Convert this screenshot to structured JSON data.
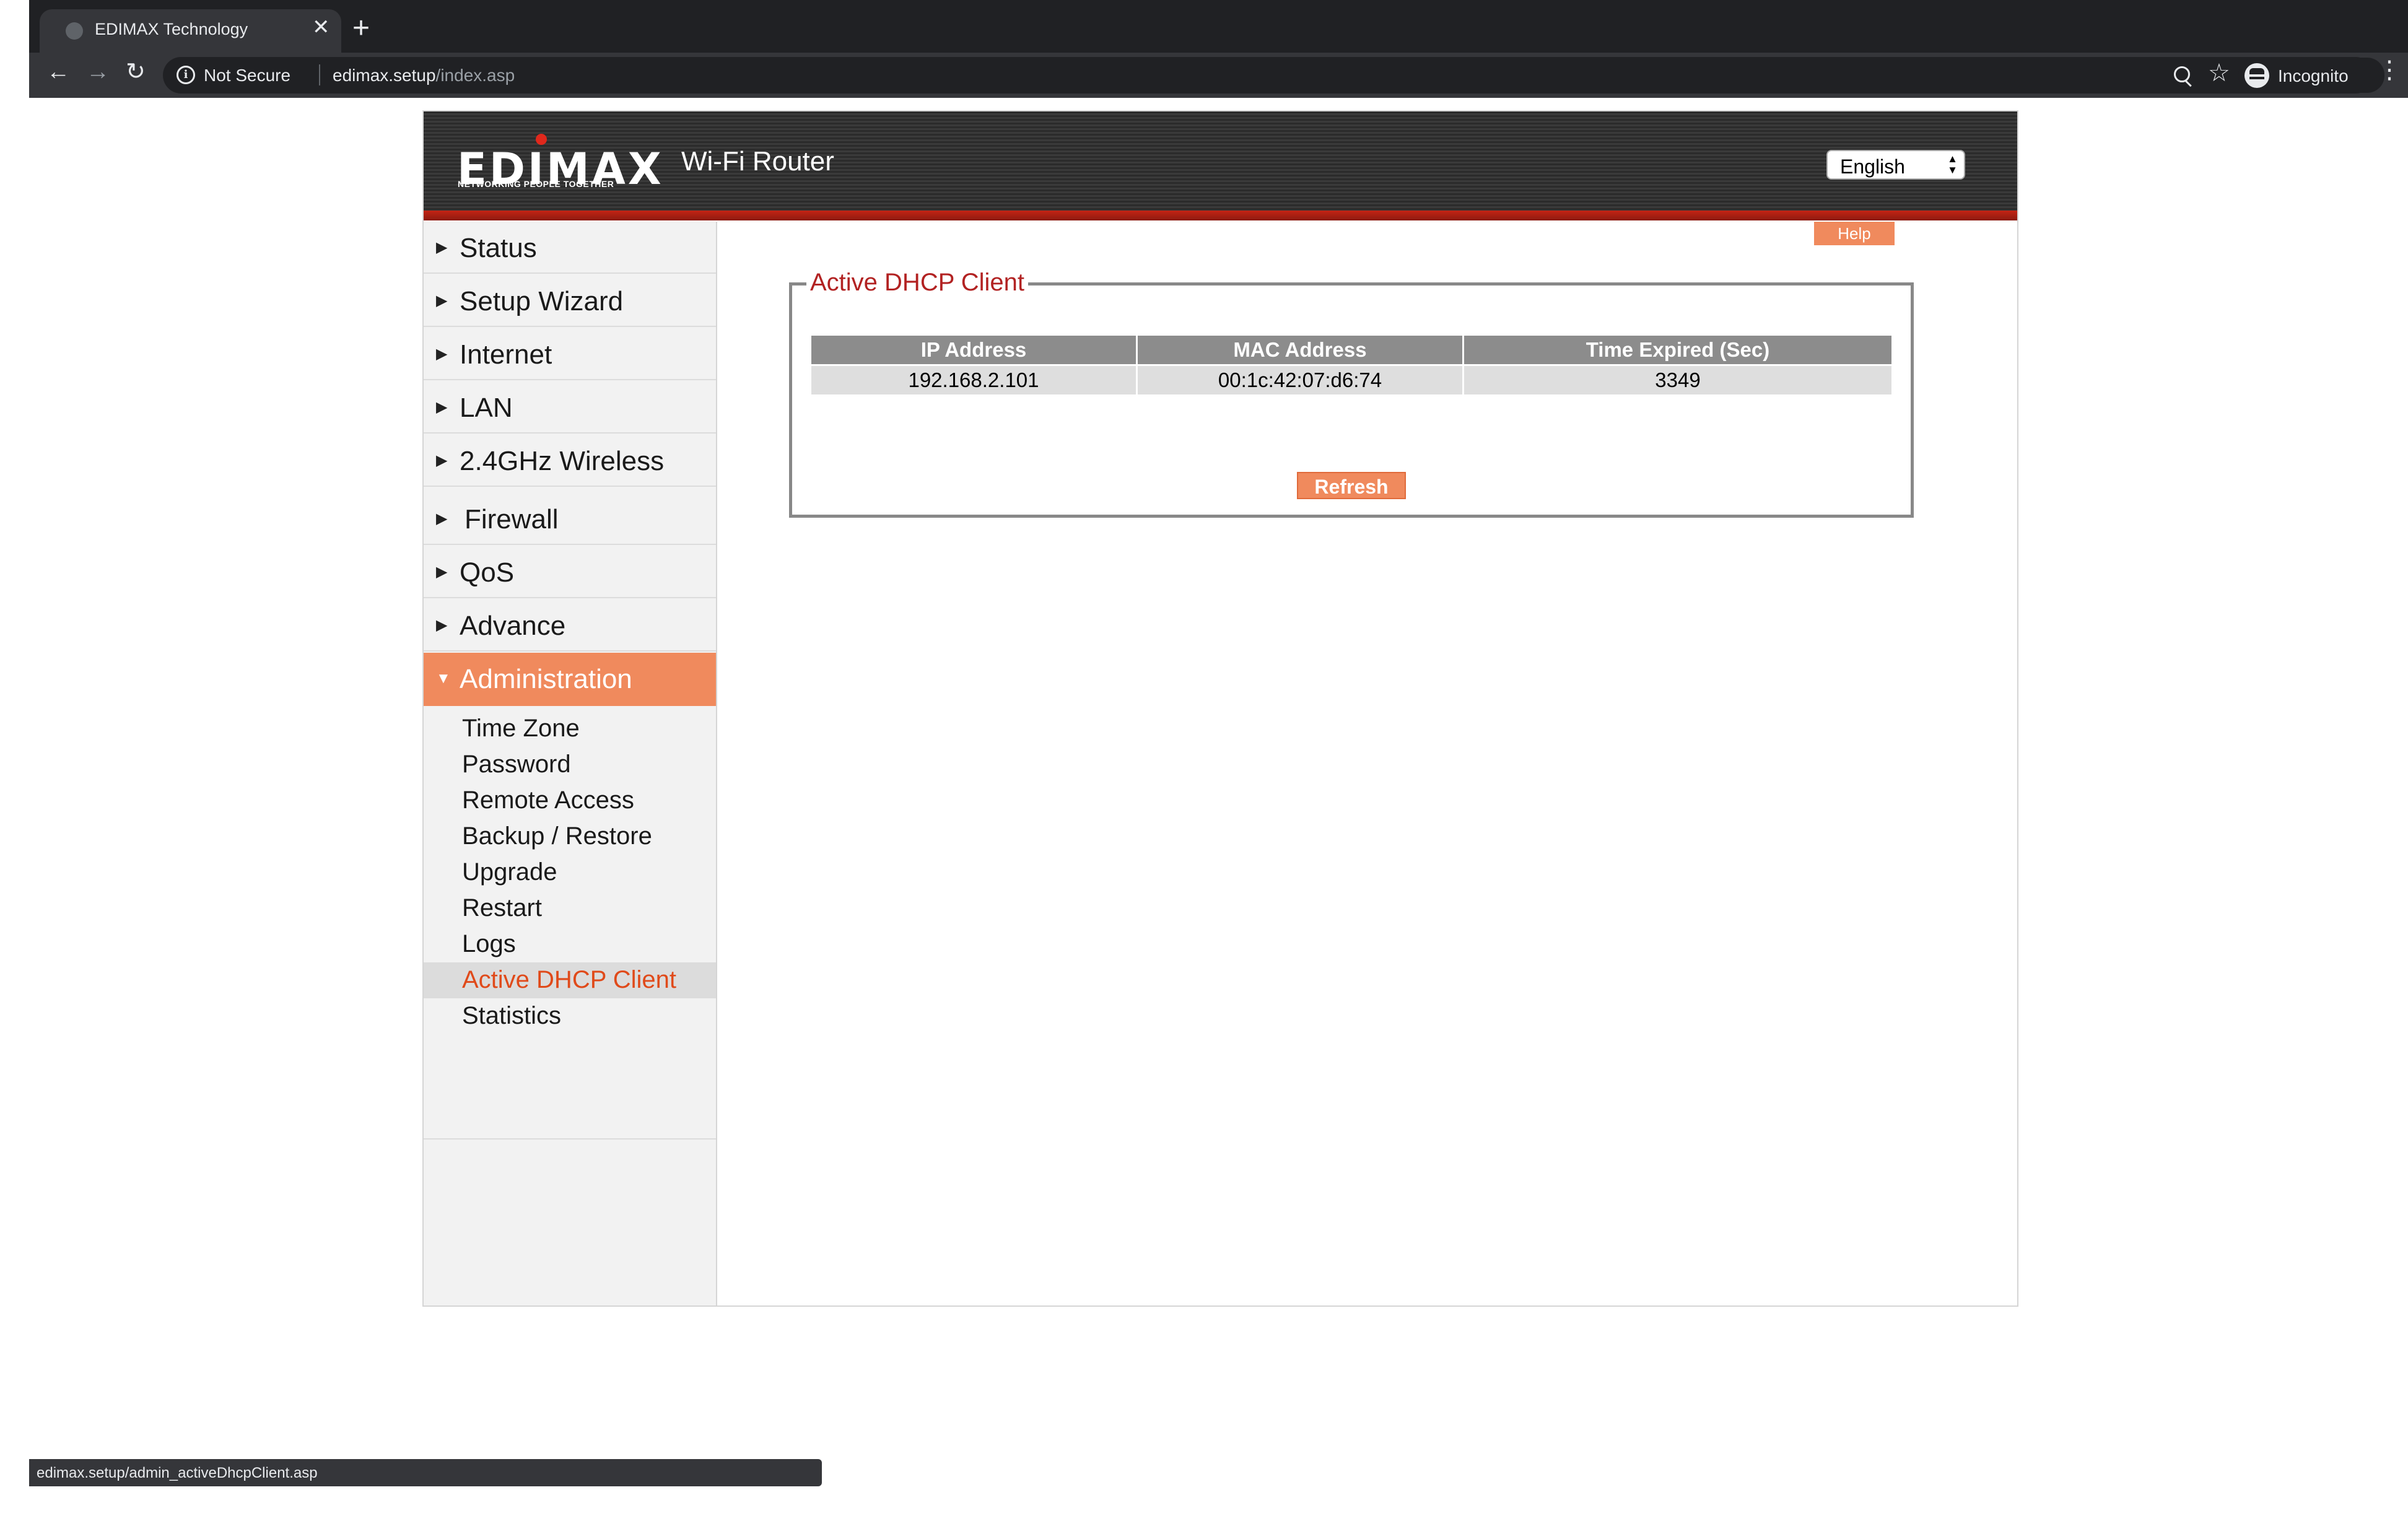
{
  "browser": {
    "tab_title": "EDIMAX Technology",
    "close_glyph": "✕",
    "new_tab_glyph": "+",
    "back_glyph": "←",
    "forward_glyph": "→",
    "reload_glyph": "↻",
    "security_label": "Not Secure",
    "url_host": "edimax.setup",
    "url_path": "/index.asp",
    "star_glyph": "☆",
    "profile_label": "Incognito",
    "menu_glyph": "⋮",
    "status_url": "edimax.setup/admin_activeDhcpClient.asp"
  },
  "header": {
    "logo_text": "EDIMAX",
    "logo_tagline": "NETWORKING PEOPLE TOGETHER",
    "product_name": "Wi-Fi Router",
    "language": "English"
  },
  "sidebar": {
    "collapsed_arrow": "▶",
    "expanded_arrow": "▼",
    "items": [
      {
        "label": "Status"
      },
      {
        "label": "Setup Wizard"
      },
      {
        "label": "Internet"
      },
      {
        "label": "LAN"
      },
      {
        "label": "2.4GHz Wireless"
      },
      {
        "label": "Firewall"
      },
      {
        "label": "QoS"
      },
      {
        "label": "Advance"
      },
      {
        "label": "Administration"
      }
    ],
    "sub_items": [
      {
        "label": "Time Zone"
      },
      {
        "label": "Password"
      },
      {
        "label": "Remote Access"
      },
      {
        "label": "Backup / Restore"
      },
      {
        "label": "Upgrade"
      },
      {
        "label": "Restart"
      },
      {
        "label": "Logs"
      },
      {
        "label": "Active DHCP Client"
      },
      {
        "label": "Statistics"
      }
    ]
  },
  "main": {
    "help_label": "Help",
    "section_title": "Active DHCP Client",
    "columns": [
      "IP Address",
      "MAC Address",
      "Time Expired (Sec)"
    ],
    "rows": [
      [
        "192.168.2.101",
        "00:1c:42:07:d6:74",
        "3349"
      ]
    ],
    "refresh_label": "Refresh"
  },
  "colors": {
    "accent": "#f08a5d",
    "selected_text": "#e04a1a",
    "legend_text": "#b22222",
    "banner_red": "#c42414"
  }
}
